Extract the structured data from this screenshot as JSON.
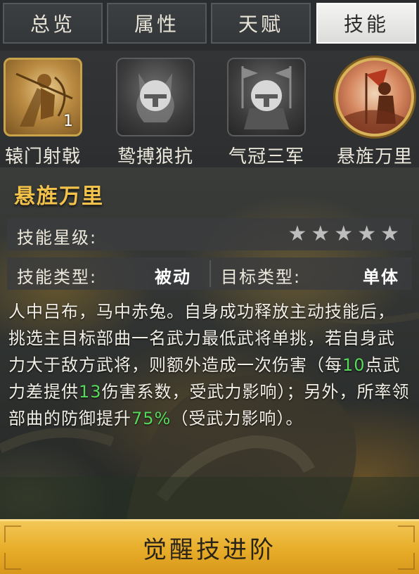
{
  "tabs": [
    {
      "label": "总览",
      "active": false
    },
    {
      "label": "属性",
      "active": false
    },
    {
      "label": "天赋",
      "active": false
    },
    {
      "label": "技能",
      "active": true
    }
  ],
  "skills": [
    {
      "name": "辕门射戟",
      "badge": "1",
      "locked": false
    },
    {
      "name": "鸷搏狼抗",
      "locked": true
    },
    {
      "name": "气冠三军",
      "locked": true
    },
    {
      "name": "悬旌万里",
      "locked": false,
      "selected": true
    }
  ],
  "detail": {
    "title": "悬旌万里",
    "star_label": "技能星级:",
    "stars_filled": 0,
    "stars_total": 5,
    "type_label": "技能类型:",
    "type_value": "被动",
    "target_label": "目标类型:",
    "target_value": "单体",
    "desc": {
      "p1": "人中吕布，马中赤兔。自身成功释放主动技能后，挑选主目标部曲一名武力最低武将单挑，若自身武力大于敌方武将，则额外造成一次伤害（每",
      "v1": "10",
      "p2": "点武力差提供",
      "v2": "13",
      "p3": "伤害系数，受武力影响）；另外，所率领部曲的防御提升",
      "v3": "75%",
      "p4": "（受武力影响）。"
    }
  },
  "awaken_button": "觉醒技进阶",
  "colors": {
    "title": "#f3c24a",
    "highlight": "#57d95c",
    "button": "#e7ac28"
  }
}
